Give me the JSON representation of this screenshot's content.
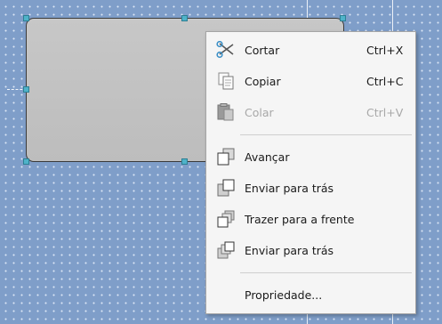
{
  "context_menu": {
    "items": [
      {
        "label": "Cortar",
        "shortcut": "Ctrl+X",
        "icon": "scissors-icon",
        "enabled": true
      },
      {
        "label": "Copiar",
        "shortcut": "Ctrl+C",
        "icon": "copy-icon",
        "enabled": true
      },
      {
        "label": "Colar",
        "shortcut": "Ctrl+V",
        "icon": "paste-icon",
        "enabled": false
      },
      {
        "label": "Avançar",
        "shortcut": "",
        "icon": "bring-forward-icon",
        "enabled": true
      },
      {
        "label": "Enviar para trás",
        "shortcut": "",
        "icon": "send-backward-icon",
        "enabled": true
      },
      {
        "label": "Trazer para a frente",
        "shortcut": "",
        "icon": "bring-to-front-icon",
        "enabled": true
      },
      {
        "label": "Enviar para trás",
        "shortcut": "",
        "icon": "send-to-back-icon",
        "enabled": true
      },
      {
        "label": "Propriedade...",
        "shortcut": "",
        "icon": "",
        "enabled": true
      }
    ]
  },
  "colors": {
    "canvas_background": "#7f9ec9",
    "shape_fill": "#c4c4c4",
    "selection_handle": "#4fb3c9",
    "menu_background": "#f5f5f5",
    "disabled_text": "#a8a8a8"
  }
}
